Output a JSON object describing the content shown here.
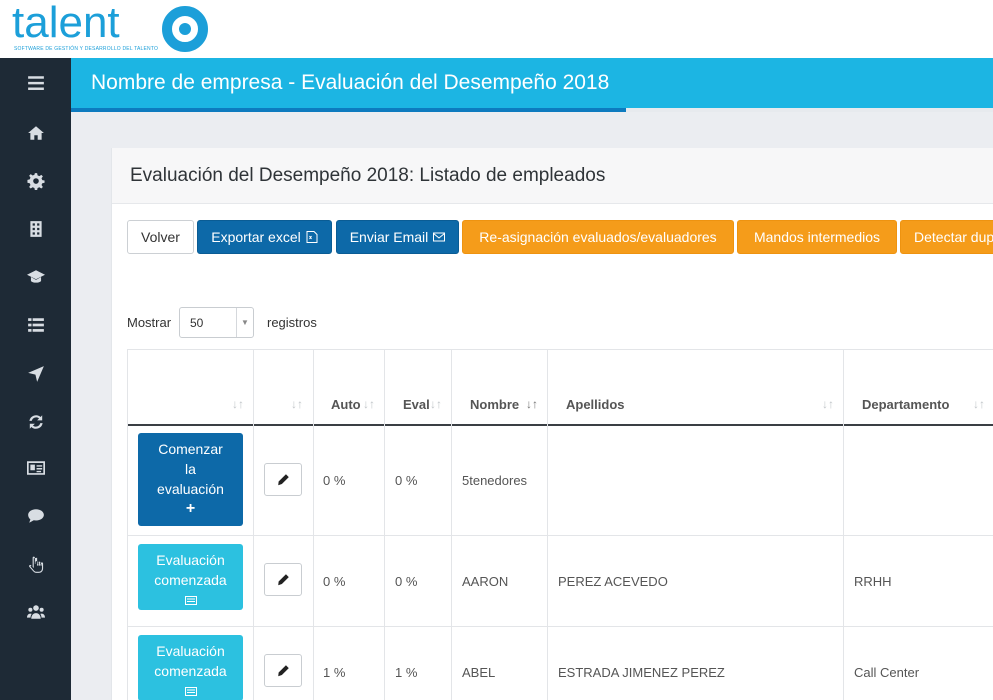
{
  "logo": {
    "word": "talent",
    "tagline": "SOFTWARE DE GESTIÓN Y DESARROLLO DEL TALENTO"
  },
  "sidebar": {
    "items": [
      {
        "icon": "menu-icon"
      },
      {
        "icon": "home-icon"
      },
      {
        "icon": "gear-icon"
      },
      {
        "icon": "building-icon"
      },
      {
        "icon": "graduation-cap-icon"
      },
      {
        "icon": "list-icon"
      },
      {
        "icon": "location-arrow-icon"
      },
      {
        "icon": "refresh-icon"
      },
      {
        "icon": "id-card-icon"
      },
      {
        "icon": "comment-icon"
      },
      {
        "icon": "hand-pointer-icon"
      },
      {
        "icon": "users-icon"
      }
    ]
  },
  "header": {
    "title": "Nombre de empresa - Evaluación del Desempeño 2018"
  },
  "panel": {
    "title": "Evaluación del Desempeño 2018: Listado de empleados"
  },
  "toolbar": {
    "back": "Volver",
    "export": "Exportar excel",
    "email": "Enviar Email",
    "reassign": "Re-asignación evaluados/evaluadores",
    "managers": "Mandos intermedios",
    "detect": "Detectar dup"
  },
  "length": {
    "label_before": "Mostrar",
    "value": "50",
    "label_after": "registros"
  },
  "table": {
    "headers": {
      "auto": "Auto",
      "eval": "Eval",
      "name": "Nombre",
      "surname": "Apellidos",
      "department": "Departamento"
    },
    "rows": [
      {
        "action_lines": [
          "Comenzar",
          "la",
          "evaluación",
          "+"
        ],
        "auto": "0 %",
        "eval": "0 %",
        "name": "5tenedores",
        "surname": "",
        "department": ""
      },
      {
        "action_lines": [
          "Evaluación",
          "comenzada"
        ],
        "auto": "0 %",
        "eval": "0 %",
        "name": "AARON",
        "surname": "PEREZ ACEVEDO",
        "department": "RRHH"
      },
      {
        "action_lines": [
          "Evaluación",
          "comenzada"
        ],
        "auto": "1 %",
        "eval": "1 %",
        "name": "ABEL",
        "surname": "ESTRADA JIMENEZ PEREZ",
        "department": "Call Center"
      }
    ]
  },
  "colors": {
    "brand": "#1c9fd9",
    "header": "#1cb5e3",
    "sidebar": "#1e2a36",
    "primary": "#0d69a8",
    "warning": "#f59c1a",
    "info": "#2cc1e0"
  }
}
